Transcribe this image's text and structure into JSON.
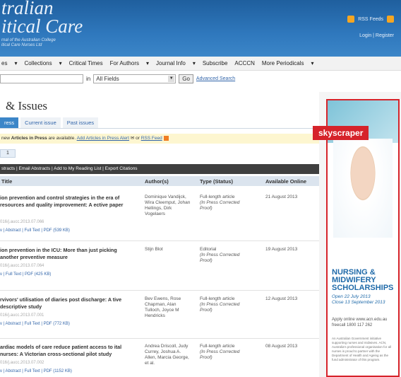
{
  "header": {
    "brand_line1": "tralian",
    "brand_line2": "itical Care",
    "brand_line3a": "rnal of the Australian College",
    "brand_line3b": "itical Care Nurses Ltd",
    "rss": "RSS Feeds",
    "login": "Login | Register"
  },
  "nav": {
    "items": [
      "es",
      "Collections",
      "Critical Times",
      "For Authors",
      "Journal Info",
      "Subscribe",
      "ACCCN",
      "More Periodicals"
    ]
  },
  "search": {
    "in_label": "in",
    "field": "All Fields",
    "go": "Go",
    "advanced": "Advanced Search"
  },
  "page": {
    "title": "& Issues",
    "tabs": [
      "ress",
      "Current issue",
      "Past issues"
    ],
    "notice_pre": "new ",
    "notice_bold": "Articles in Press",
    "notice_mid": " are available. ",
    "notice_link1": "Add Articles in Press Alert",
    "notice_or": " or ",
    "notice_link2": "RSS Feed",
    "page_num": "1",
    "toolbar": "stracts | Email Abstracts | Add to My Reading List | Export Citations",
    "columns": [
      "Title",
      "Author(s)",
      "Type (Status)",
      "Available Online"
    ]
  },
  "rows": [
    {
      "title": "ion prevention and control strategies in the era of resources and quality improvement: A ective paper",
      "doi": "016/j.aucc.2013.07.066",
      "links": "v | Abstract | Full Text | PDF (539 KB)",
      "authors": "Dominique Vandijck, Wira Cleemput, Johan Hellings, Dirk Vogelaers",
      "type": "Full-length article",
      "status": "(In Press Corrected Proof)",
      "date": "21 August 2013"
    },
    {
      "title": "ion prevention in the ICU: More than just picking another preventive measure",
      "doi": "016/j.aucc.2013.07.064",
      "links": "v | Full Text | PDF (425 KB)",
      "authors": "Stijn Blot",
      "type": "Editorial",
      "status": "(In Press Corrected Proof)",
      "date": "19 August 2013"
    },
    {
      "title": "rvivors' utilisation of diaries post discharge: A tive descriptive study",
      "doi": "016/j.aucc.2013.07.001",
      "links": "v | Abstract | Full Text | PDF (772 KB)",
      "authors": "Bev Ewens, Rose Chapman, Alan Tulloch, Joyce M Hendricks",
      "type": "Full-length article",
      "status": "(In Press Corrected Proof)",
      "date": "12 August 2013"
    },
    {
      "title": "ardiac models of care reduce patient access to ital nurses: A Victorian cross-sectional pilot study",
      "doi": "016/j.aucc.2013.07.002",
      "links": "v | Abstract | Full Text | PDF (1152 KB)",
      "authors": "Andrea Driscoll, Judy Currey, Joshua A. Allen, Marcia George, et al.",
      "type": "Full-length article",
      "status": "(In Press Corrected Proof)",
      "date": "08 August 2013"
    }
  ],
  "ad": {
    "tag": "skyscraper",
    "heading": "NURSING & MIDWIFERY SCHOLARSHIPS",
    "open": "Open 22 July 2013",
    "close": "Close 13 September 2013",
    "apply": "Apply online www.acn.edu.au freecall 1800 117 262",
    "fine": "An Australian Government initiative supporting nurses and midwives. ACN, Australia's professional organisation for all nurses is proud to partner with the Department of Health and Ageing as the fund administrator of this program."
  }
}
